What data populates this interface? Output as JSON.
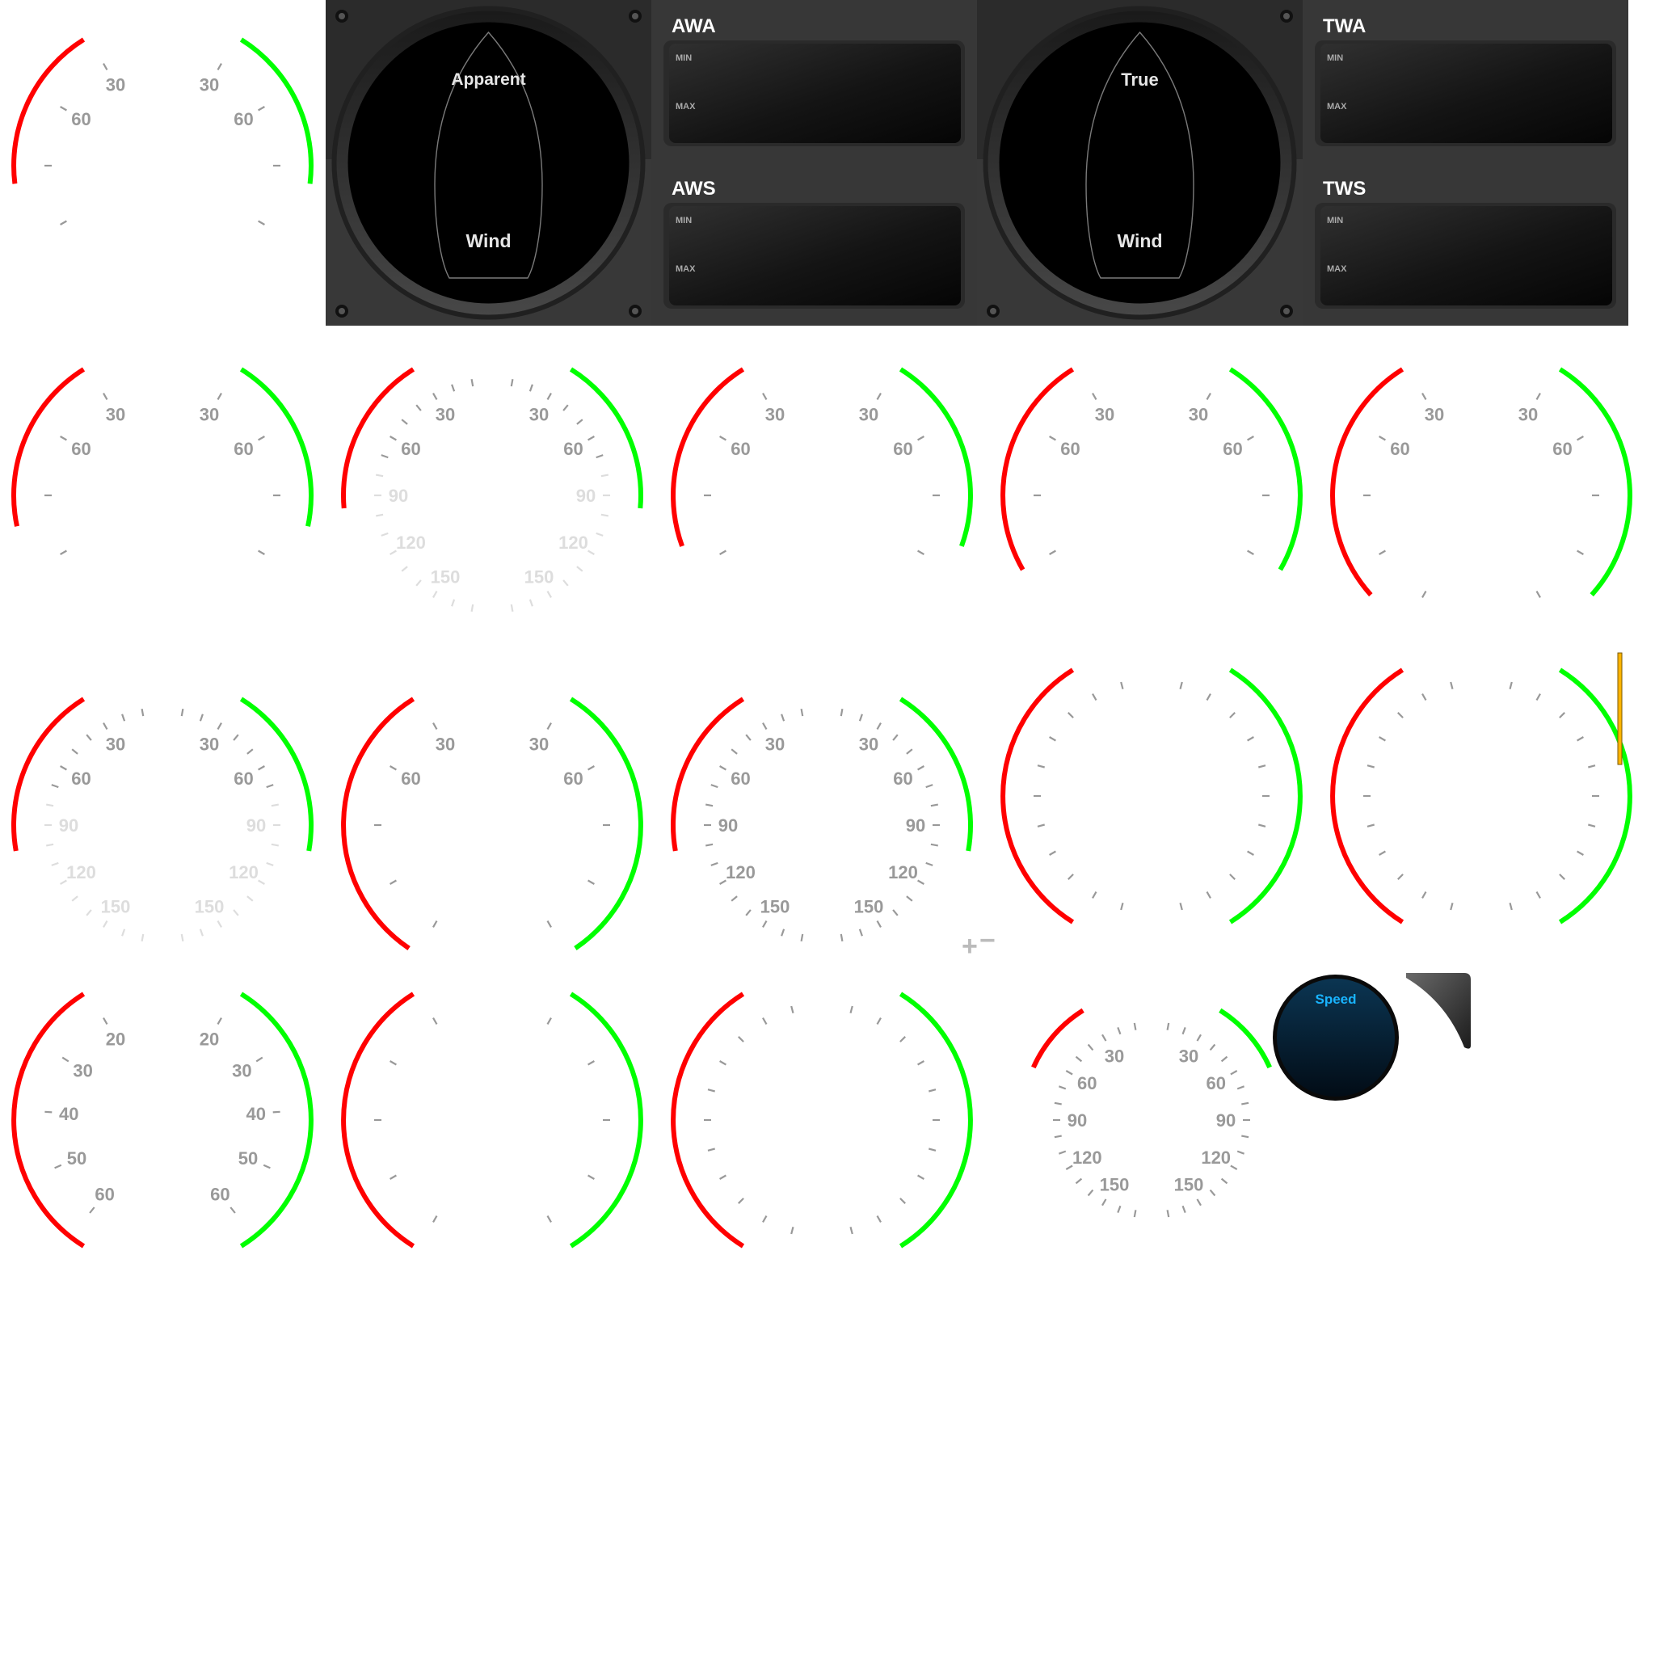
{
  "palette": {
    "port": "#ff0000",
    "starboard": "#00ff00",
    "tick_dark": "#999999",
    "tick_light": "#dddddd",
    "panel": "#343434",
    "panel_dark": "#262626",
    "panel_light": "#3c3c3c",
    "highlight": "#ffb400",
    "speed_label": "#19b4ff",
    "plus_minus": "#bbbbbb"
  },
  "wind_panels": [
    {
      "dial": {
        "top_label": "Apparent",
        "bottom_label": "Wind"
      },
      "readouts": [
        {
          "title": "AWA",
          "min_label": "MIN",
          "max_label": "MAX"
        },
        {
          "title": "AWS",
          "min_label": "MIN",
          "max_label": "MAX"
        }
      ]
    },
    {
      "dial": {
        "top_label": "True",
        "bottom_label": "Wind"
      },
      "readouts": [
        {
          "title": "TWA",
          "min_label": "MIN",
          "max_label": "MAX"
        },
        {
          "title": "TWS",
          "min_label": "MIN",
          "max_label": "MAX"
        }
      ]
    }
  ],
  "gauges": [
    {
      "id": "r1c1",
      "labels": [
        "30",
        "60"
      ],
      "tone": "dark"
    },
    {
      "id": "r2c1",
      "labels": [
        "30",
        "60"
      ],
      "tone": "dark"
    },
    {
      "id": "r2c2",
      "labels": [
        "30",
        "60",
        "90",
        "120",
        "150"
      ],
      "tone": "mixed"
    },
    {
      "id": "r2c3",
      "labels": [
        "30",
        "60"
      ],
      "tone": "dark"
    },
    {
      "id": "r2c4",
      "labels": [
        "30",
        "60"
      ],
      "tone": "dark"
    },
    {
      "id": "r2c5",
      "labels": [
        "30",
        "60"
      ],
      "tone": "dark"
    },
    {
      "id": "r3c1",
      "labels": [
        "30",
        "60",
        "90",
        "120",
        "150"
      ],
      "tone": "mixed"
    },
    {
      "id": "r3c2",
      "labels": [
        "30",
        "60"
      ],
      "tone": "dark"
    },
    {
      "id": "r3c3",
      "labels": [
        "30",
        "60",
        "90",
        "120",
        "150"
      ],
      "tone": "dark"
    },
    {
      "id": "r3c4",
      "labels": [],
      "tone": "dark"
    },
    {
      "id": "r3c5",
      "labels": [],
      "tone": "dark"
    },
    {
      "id": "r4c1",
      "labels": [
        "20",
        "30",
        "40",
        "50",
        "60"
      ],
      "tone": "dark"
    },
    {
      "id": "r4c2",
      "labels": [],
      "tone": "dark"
    },
    {
      "id": "r4c3",
      "labels": [],
      "tone": "dark"
    },
    {
      "id": "r4c4",
      "labels": [
        "30",
        "60",
        "90",
        "120",
        "150"
      ],
      "tone": "dark"
    }
  ],
  "plus_minus": {
    "plus": "+",
    "minus": "−"
  },
  "speed_knob": {
    "label": "Speed"
  }
}
